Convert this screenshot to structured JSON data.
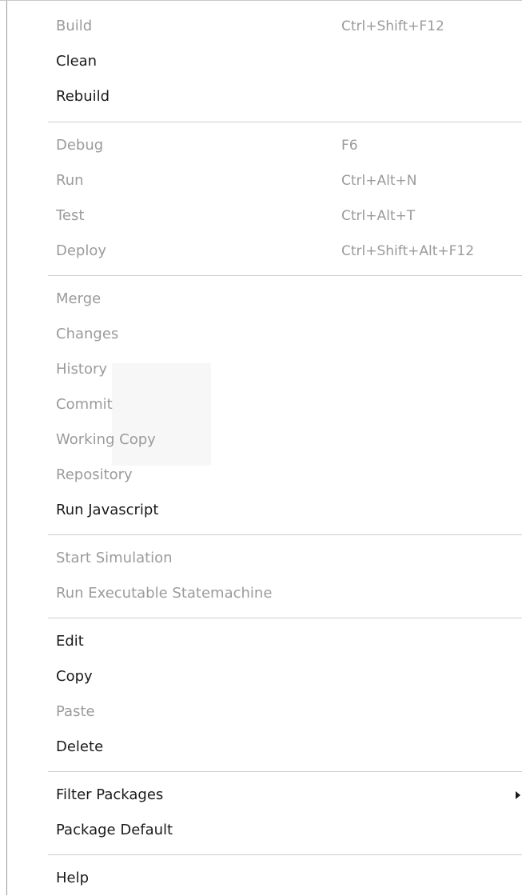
{
  "menu": {
    "items": [
      {
        "label": "Build",
        "shortcut": "Ctrl+Shift+F12",
        "enabled": false
      },
      {
        "label": "Clean",
        "shortcut": "",
        "enabled": true
      },
      {
        "label": "Rebuild",
        "shortcut": "",
        "enabled": true
      },
      {
        "label": "Debug",
        "shortcut": "F6",
        "enabled": false
      },
      {
        "label": "Run",
        "shortcut": "Ctrl+Alt+N",
        "enabled": false
      },
      {
        "label": "Test",
        "shortcut": "Ctrl+Alt+T",
        "enabled": false
      },
      {
        "label": "Deploy",
        "shortcut": "Ctrl+Shift+Alt+F12",
        "enabled": false
      },
      {
        "label": "Merge",
        "shortcut": "",
        "enabled": false
      },
      {
        "label": "Changes",
        "shortcut": "",
        "enabled": false
      },
      {
        "label": "History",
        "shortcut": "",
        "enabled": false
      },
      {
        "label": "Commit",
        "shortcut": "",
        "enabled": false
      },
      {
        "label": "Working Copy",
        "shortcut": "",
        "enabled": false
      },
      {
        "label": "Repository",
        "shortcut": "",
        "enabled": false
      },
      {
        "label": "Run Javascript",
        "shortcut": "",
        "enabled": true
      },
      {
        "label": "Start Simulation",
        "shortcut": "",
        "enabled": false
      },
      {
        "label": "Run Executable Statemachine",
        "shortcut": "",
        "enabled": false
      },
      {
        "label": "Edit",
        "shortcut": "",
        "enabled": true
      },
      {
        "label": "Copy",
        "shortcut": "",
        "enabled": true
      },
      {
        "label": "Paste",
        "shortcut": "",
        "enabled": false
      },
      {
        "label": "Delete",
        "shortcut": "",
        "enabled": true
      },
      {
        "label": "Filter Packages",
        "shortcut": "",
        "enabled": true,
        "submenu": true
      },
      {
        "label": "Package Default",
        "shortcut": "",
        "enabled": true
      },
      {
        "label": "Help",
        "shortcut": "",
        "enabled": true
      }
    ]
  },
  "colors": {
    "enabled_text": "#1a1a1a",
    "disabled_text": "#9b9b9b",
    "separator": "#cfcfcf"
  },
  "icons": {
    "submenu_arrow": "chevron-right-icon"
  }
}
